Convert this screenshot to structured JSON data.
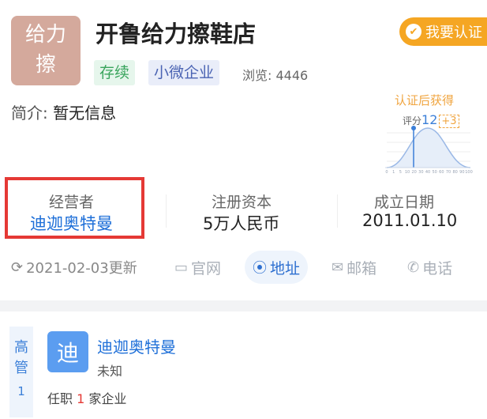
{
  "company": {
    "logo_line1": "给力",
    "logo_line2": "擦",
    "logo_color": "#d4a99c",
    "name": "开鲁给力擦鞋店",
    "certify_label": "我要认证",
    "tags": [
      "存续",
      "小微企业"
    ],
    "views_label": "浏览:",
    "views_count": "4446",
    "intro_label": "简介:",
    "intro_value": "暂无信息"
  },
  "score_card": {
    "title": "认证后获得",
    "score_label": "评分",
    "score_value": "12",
    "bonus": "+3",
    "axis_ticks": [
      "0",
      "1",
      "5",
      "10",
      "20",
      "30",
      "40",
      "50",
      "60",
      "70",
      "80",
      "90",
      "100"
    ]
  },
  "stats": [
    {
      "label": "经营者",
      "value": "迪迦奥特曼"
    },
    {
      "label": "注册资本",
      "value": "5万人民币"
    },
    {
      "label": "成立日期",
      "value": "2011.01.10"
    }
  ],
  "actions": {
    "updated": "2021-02-03更新",
    "website": "官网",
    "address": "地址",
    "email": "邮箱",
    "phone": "电话"
  },
  "executives": {
    "tab_chars": [
      "高",
      "管"
    ],
    "count": "1",
    "avatar_char": "迪",
    "person_name": "迪迦奥特曼",
    "person_role": "未知",
    "tenure_prefix": "任职",
    "tenure_count": "1",
    "tenure_suffix": "家企业"
  },
  "colors": {
    "accent": "#1e6fd8",
    "certify": "#f5a623",
    "highlight": "#e53935"
  }
}
